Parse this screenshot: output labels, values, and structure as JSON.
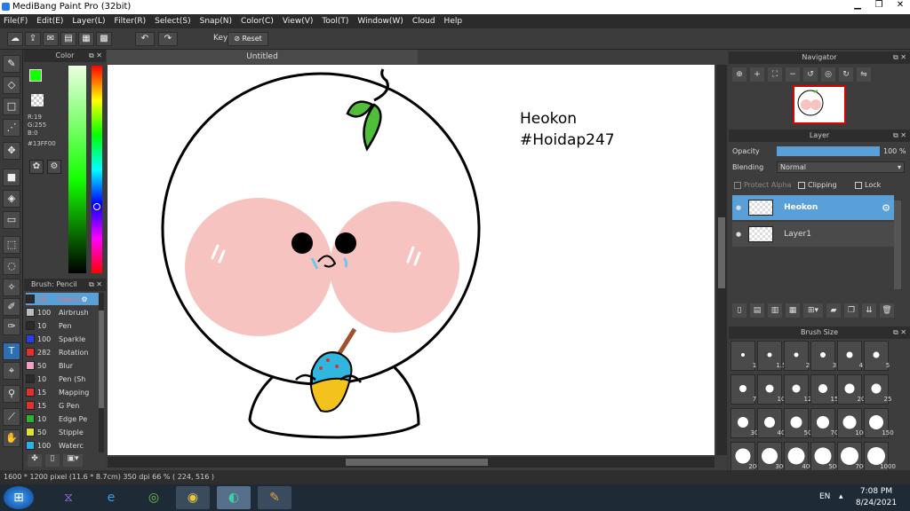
{
  "window": {
    "title": "MediBang Paint Pro (32bit)"
  },
  "menu": [
    "File(F)",
    "Edit(E)",
    "Layer(L)",
    "Filter(R)",
    "Select(S)",
    "Snap(N)",
    "Color(C)",
    "View(V)",
    "Tool(T)",
    "Window(W)",
    "Cloud",
    "Help"
  ],
  "toolbar": {
    "key_label": "Key",
    "reset_label": "Reset"
  },
  "color_panel": {
    "title": "Color",
    "r": "R:19",
    "g": "G:255",
    "b": "B:0",
    "hex": "#13FF00",
    "fg_color": "#13FF00",
    "bg_color": "#000000"
  },
  "brush_panel": {
    "title": "Brush: Pencil",
    "items": [
      {
        "size": "10",
        "name": "Pencil",
        "color": "#2b2b2b",
        "active": true
      },
      {
        "size": "100",
        "name": "Airbrush",
        "color": "#bdbdbd"
      },
      {
        "size": "10",
        "name": "Pen",
        "color": "#2b2b2b"
      },
      {
        "size": "100",
        "name": "Sparkle",
        "color": "#2a3fe0"
      },
      {
        "size": "282",
        "name": "Rotation",
        "color": "#e03030"
      },
      {
        "size": "50",
        "name": "Blur",
        "color": "#f0a0c0"
      },
      {
        "size": "10",
        "name": "Pen (Sh",
        "color": "#2b2b2b"
      },
      {
        "size": "15",
        "name": "Mapping",
        "color": "#e03030"
      },
      {
        "size": "15",
        "name": "G Pen",
        "color": "#e03030"
      },
      {
        "size": "10",
        "name": "Edge Pe",
        "color": "#2fb02f"
      },
      {
        "size": "50",
        "name": "Stipple",
        "color": "#e0e030"
      },
      {
        "size": "100",
        "name": "Waterc",
        "color": "#30b0e0"
      }
    ]
  },
  "document": {
    "tab_title": "Untitled",
    "text1": "Heokon",
    "text2": "#Hoidap247"
  },
  "navigator": {
    "title": "Navigator"
  },
  "layer_panel": {
    "title": "Layer",
    "opacity_label": "Opacity",
    "opacity_value": "100 %",
    "opacity": 1.0,
    "blending_label": "Blending",
    "blending_value": "Normal",
    "protect_alpha": "Protect Alpha",
    "clipping": "Clipping",
    "lock": "Lock",
    "layers": [
      {
        "name": "Heokon",
        "active": true
      },
      {
        "name": "Layer1",
        "active": false
      }
    ]
  },
  "brush_size": {
    "title": "Brush Size",
    "sizes": [
      "1",
      "1.5",
      "2",
      "3",
      "4",
      "5",
      "7",
      "10",
      "12",
      "15",
      "20",
      "25",
      "30",
      "40",
      "50",
      "70",
      "100",
      "150",
      "200",
      "300",
      "400",
      "500",
      "700",
      "1000"
    ]
  },
  "status": {
    "text": "1600 * 1200 pixel   (11.6 * 8.7cm)   350 dpi   66 %   ( 224, 516 )"
  },
  "taskbar": {
    "lang": "EN",
    "time": "7:08 PM",
    "date": "8/24/2021"
  }
}
